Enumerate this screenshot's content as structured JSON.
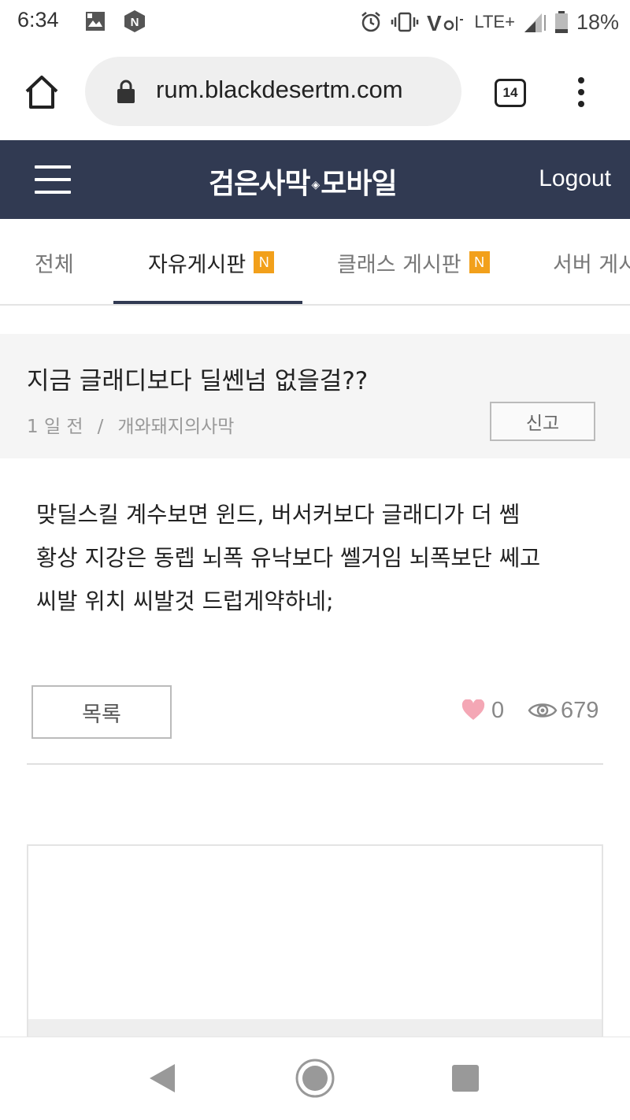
{
  "status_bar": {
    "time": "6:34",
    "network": "LTE+",
    "battery": "18%",
    "icons": [
      "photo-icon",
      "n-app-icon",
      "alarm-icon",
      "vibrate-icon",
      "volte-icon",
      "signal-icon",
      "battery-icon"
    ]
  },
  "browser": {
    "url": "rum.blackdesertm.com",
    "tab_count": "14",
    "icons": [
      "home-icon",
      "lock-icon",
      "more-icon"
    ]
  },
  "header": {
    "logo_left": "검은사막",
    "logo_right": "모바일",
    "logout_label": "Logout",
    "background": "#313a52"
  },
  "tabs": [
    {
      "label": "전체",
      "badge": "",
      "active": false
    },
    {
      "label": "자유게시판",
      "badge": "N",
      "active": true
    },
    {
      "label": "클래스 게시판",
      "badge": "N",
      "active": false
    },
    {
      "label": "서버 게시",
      "badge": "",
      "active": false
    }
  ],
  "badge_color": "#f2a01b",
  "post": {
    "title": "지금 글래디보다 딜쎈넘 없을걸??",
    "time_ago": "1 일 전",
    "separator": "/",
    "author": "개와돼지의사막",
    "report_label": "신고",
    "body": [
      "맞딜스킬 계수보면 윈드, 버서커보다 글래디가 더 쎔",
      "황상 지강은 동렙 뇌폭 유낙보다 쎌거임 뇌폭보단 쎄고",
      "씨발 위치 씨발것 드럽게약하네;"
    ],
    "list_label": "목록",
    "likes": "0",
    "views": "679",
    "like_color": "#f4a7b5"
  }
}
